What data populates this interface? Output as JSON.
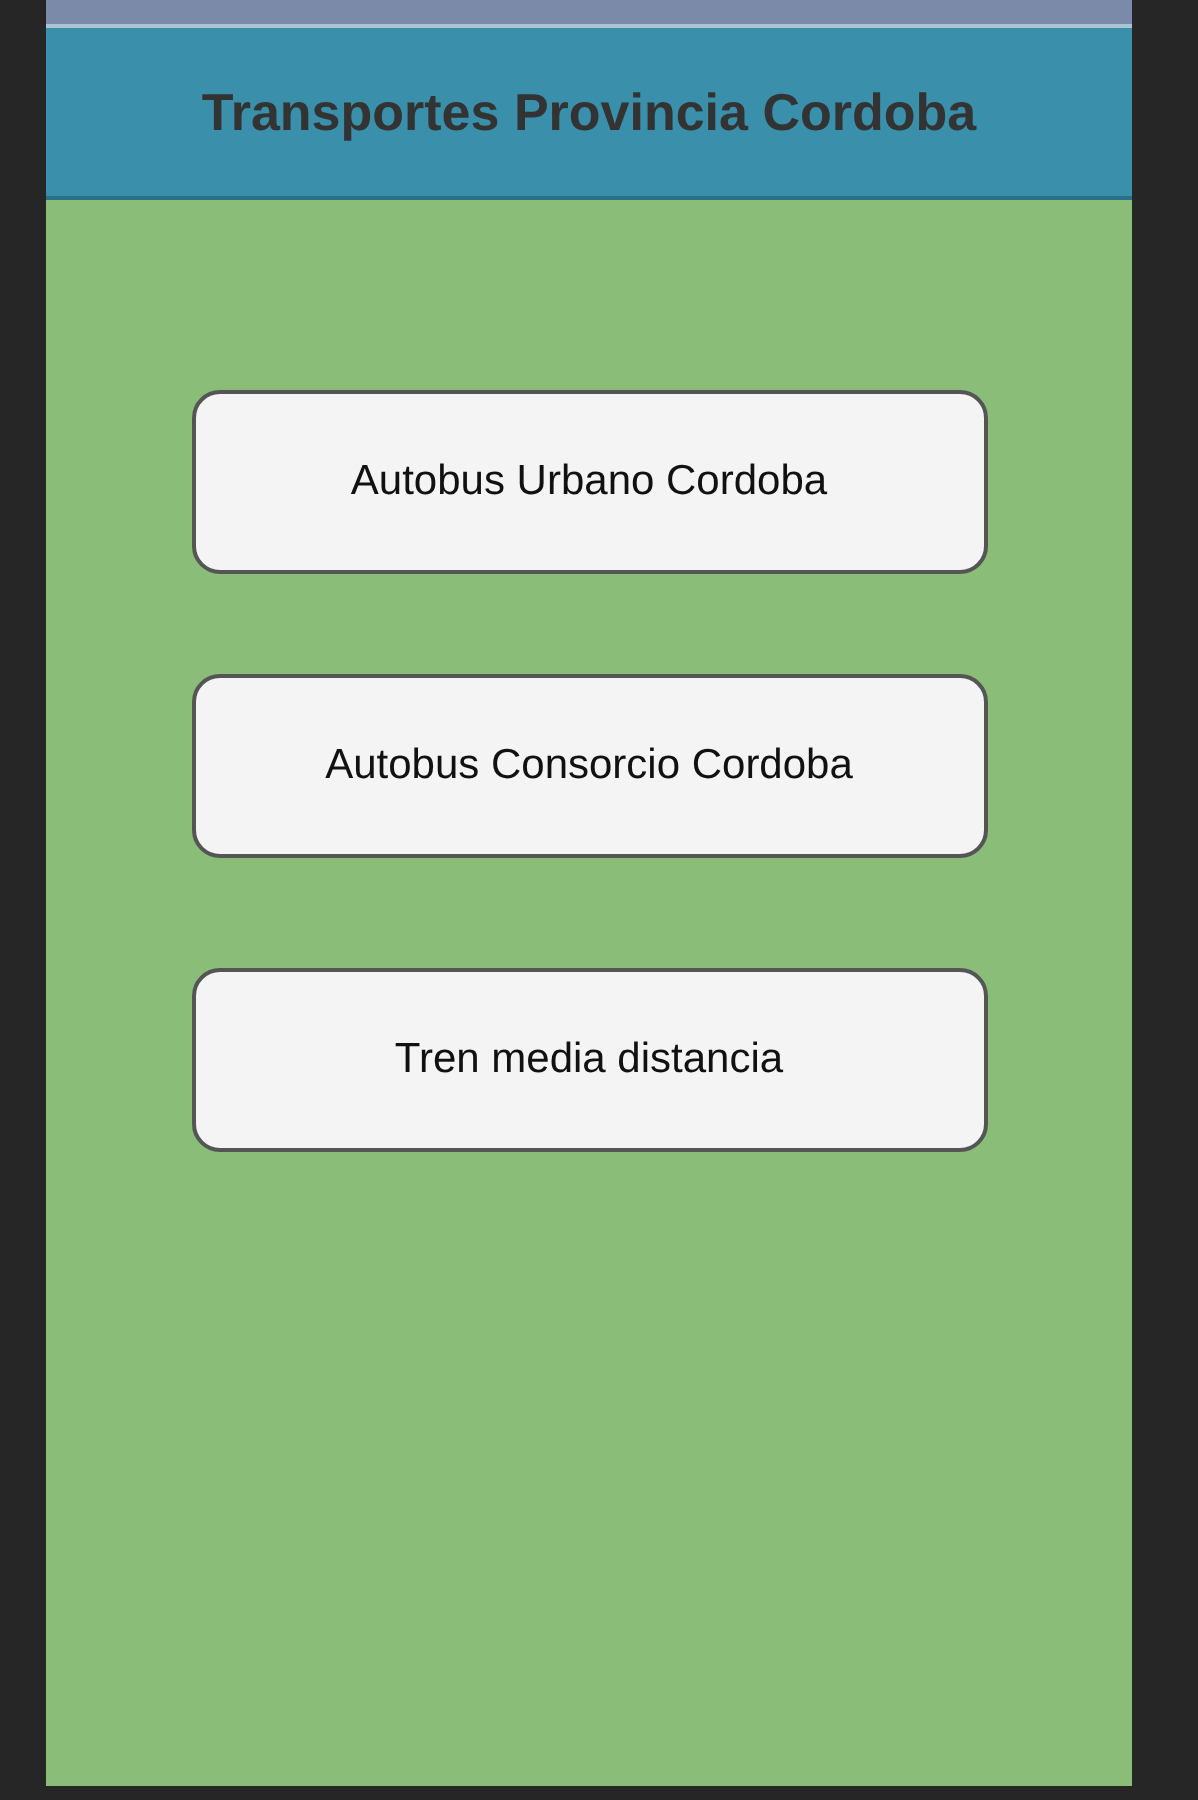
{
  "header": {
    "title": "Transportes Provincia Cordoba"
  },
  "buttons": [
    "Autobus Urbano Cordoba",
    "Autobus Consorcio Cordoba",
    "Tren media distancia"
  ]
}
